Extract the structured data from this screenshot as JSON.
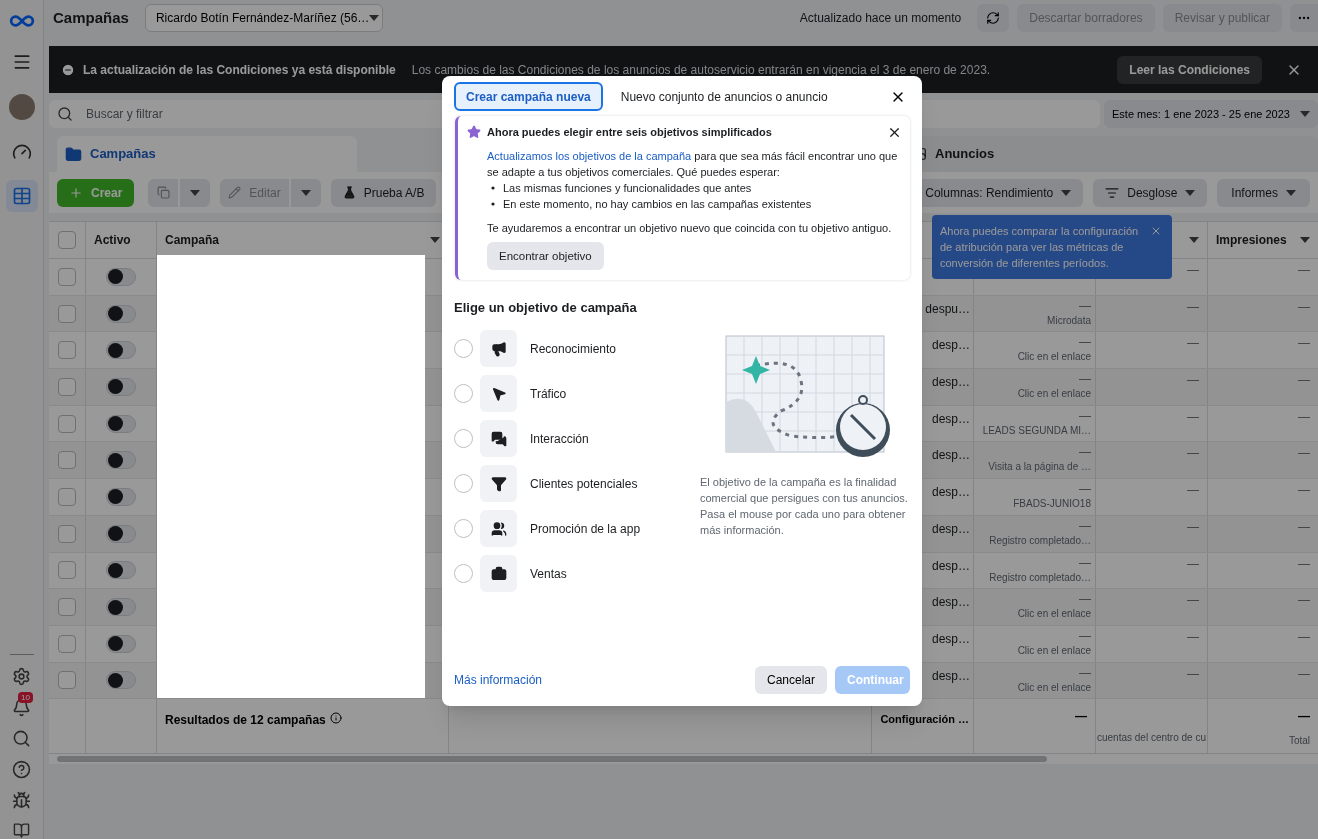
{
  "sidebar": {
    "items": [
      {
        "selected": false
      },
      {
        "selected": false
      },
      {
        "selected": true
      }
    ],
    "notification_count": "10"
  },
  "top_bar": {
    "title": "Campañas",
    "account": "Ricardo Botín Fernández-Maríñez (56…",
    "status": "Actualizado hace un momento",
    "buttons": [
      {
        "label": "Descartar borradores",
        "disabled": true
      },
      {
        "label": "Revisar y publicar",
        "disabled": true
      }
    ]
  },
  "banner": {
    "title": "La actualización de las Condiciones ya está disponible",
    "text": "Los cambios de las Condiciones de los anuncios de autoservicio entrarán en vigencia el 3 de enero de 2023.",
    "button": "Leer las Condiciones"
  },
  "search": {
    "placeholder": "Buscar y filtrar"
  },
  "date_range": "Este mes: 1 ene 2023 - 25 ene 2023",
  "tabs": [
    {
      "label": "Campañas",
      "selected": true
    },
    {
      "label": "Anuncios",
      "selected": false
    }
  ],
  "toolbar": {
    "create": "Crear",
    "edit": {
      "label": "Editar",
      "disabled": true
    },
    "ab_test": "Prueba A/B",
    "columns": "Columnas: Rendimiento",
    "breakdown": "Desglose",
    "reports": "Informes"
  },
  "table": {
    "select_all_checked": false,
    "headers": [
      "Activo",
      "Campaña",
      "Impresiones"
    ],
    "rows": [
      {
        "checked": false,
        "on": false,
        "column_7": "—",
        "impressions": "—"
      },
      {
        "checked": false,
        "on": false,
        "column_5": "despu…",
        "column_6": "—",
        "column_6_note": "Microdata",
        "column_7": "—",
        "impressions": "—"
      },
      {
        "checked": false,
        "on": false,
        "column_5": "desp…",
        "column_6": "—",
        "column_6_note": "Clic en el enlace",
        "column_7": "—",
        "impressions": "—"
      },
      {
        "checked": false,
        "on": false,
        "column_5": "desp…",
        "column_6": "—",
        "column_6_note": "Clic en el enlace",
        "column_7": "—",
        "impressions": "—"
      },
      {
        "checked": false,
        "on": false,
        "column_5": "desp…",
        "column_6": "—",
        "column_6_note": "LEADS SEGUNDA MI…",
        "column_7": "—",
        "impressions": "—"
      },
      {
        "checked": false,
        "on": false,
        "column_5": "desp…",
        "column_6": "—",
        "column_6_note": "Visita a la página de …",
        "column_7": "—",
        "impressions": "—"
      },
      {
        "checked": false,
        "on": false,
        "column_5": "desp…",
        "column_6": "—",
        "column_6_note": "FBADS-JUNIO18",
        "column_7": "—",
        "impressions": "—"
      },
      {
        "checked": false,
        "on": false,
        "column_5": "desp…",
        "column_6": "—",
        "column_6_note": "Registro completado…",
        "column_7": "—",
        "impressions": "—"
      },
      {
        "checked": false,
        "on": false,
        "column_5": "desp…",
        "column_6": "—",
        "column_6_note": "Registro completado…",
        "column_7": "—",
        "impressions": "—"
      },
      {
        "checked": false,
        "on": false,
        "column_5": "desp…",
        "column_6": "—",
        "column_6_note": "Clic en el enlace",
        "column_7": "—",
        "impressions": "—"
      },
      {
        "checked": false,
        "on": false,
        "column_5": "desp…",
        "column_6": "—",
        "column_6_note": "Clic en el enlace",
        "column_7": "—",
        "impressions": "—"
      },
      {
        "checked": false,
        "on": false,
        "column_5": "desp…",
        "column_6": "—",
        "column_6_note": "Clic en el enlace",
        "column_7": "—",
        "impressions": "—"
      }
    ],
    "footer": {
      "summary": "Resultados de 12 campañas",
      "column_5": "Configuración …",
      "column_6": "—",
      "column_7": "cuentas del centro de cu",
      "impressions": "—",
      "impressions_note": "Total"
    }
  },
  "tooltip": {
    "text": "Ahora puedes comparar la configuración de atribución para ver las métricas de conversión de diferentes períodos."
  },
  "modal": {
    "tabs": [
      {
        "label": "Crear campaña nueva",
        "selected": true
      },
      {
        "label": "Nuevo conjunto de anuncios o anuncio",
        "selected": false
      }
    ],
    "notice": {
      "title": "Ahora puedes elegir entre seis objetivos simplificados",
      "link": "Actualizamos los objetivos de la campaña",
      "text": " para que sea más fácil encontrar uno que se adapte a tus objetivos comerciales. Qué puedes esperar:",
      "bullets": [
        "Las mismas funciones y funcionalidades que antes",
        "En este momento, no hay cambios en las campañas existentes"
      ],
      "closing": "Te ayudaremos a encontrar un objetivo nuevo que coincida con tu objetivo antiguo.",
      "button": "Encontrar objetivo"
    },
    "heading": "Elige un objetivo de campaña",
    "objectives": [
      {
        "label": "Reconocimiento",
        "selected": false
      },
      {
        "label": "Tráfico",
        "selected": false
      },
      {
        "label": "Interacción",
        "selected": false
      },
      {
        "label": "Clientes potenciales",
        "selected": false
      },
      {
        "label": "Promoción de la app",
        "selected": false
      },
      {
        "label": "Ventas",
        "selected": false
      }
    ],
    "description": "El objetivo de la campaña es la finalidad comercial que persigues con tus anuncios. Pasa el mouse por cada uno para obtener más información.",
    "more_link": "Más información",
    "cancel": "Cancelar",
    "continue": {
      "label": "Continuar",
      "disabled": true
    }
  }
}
